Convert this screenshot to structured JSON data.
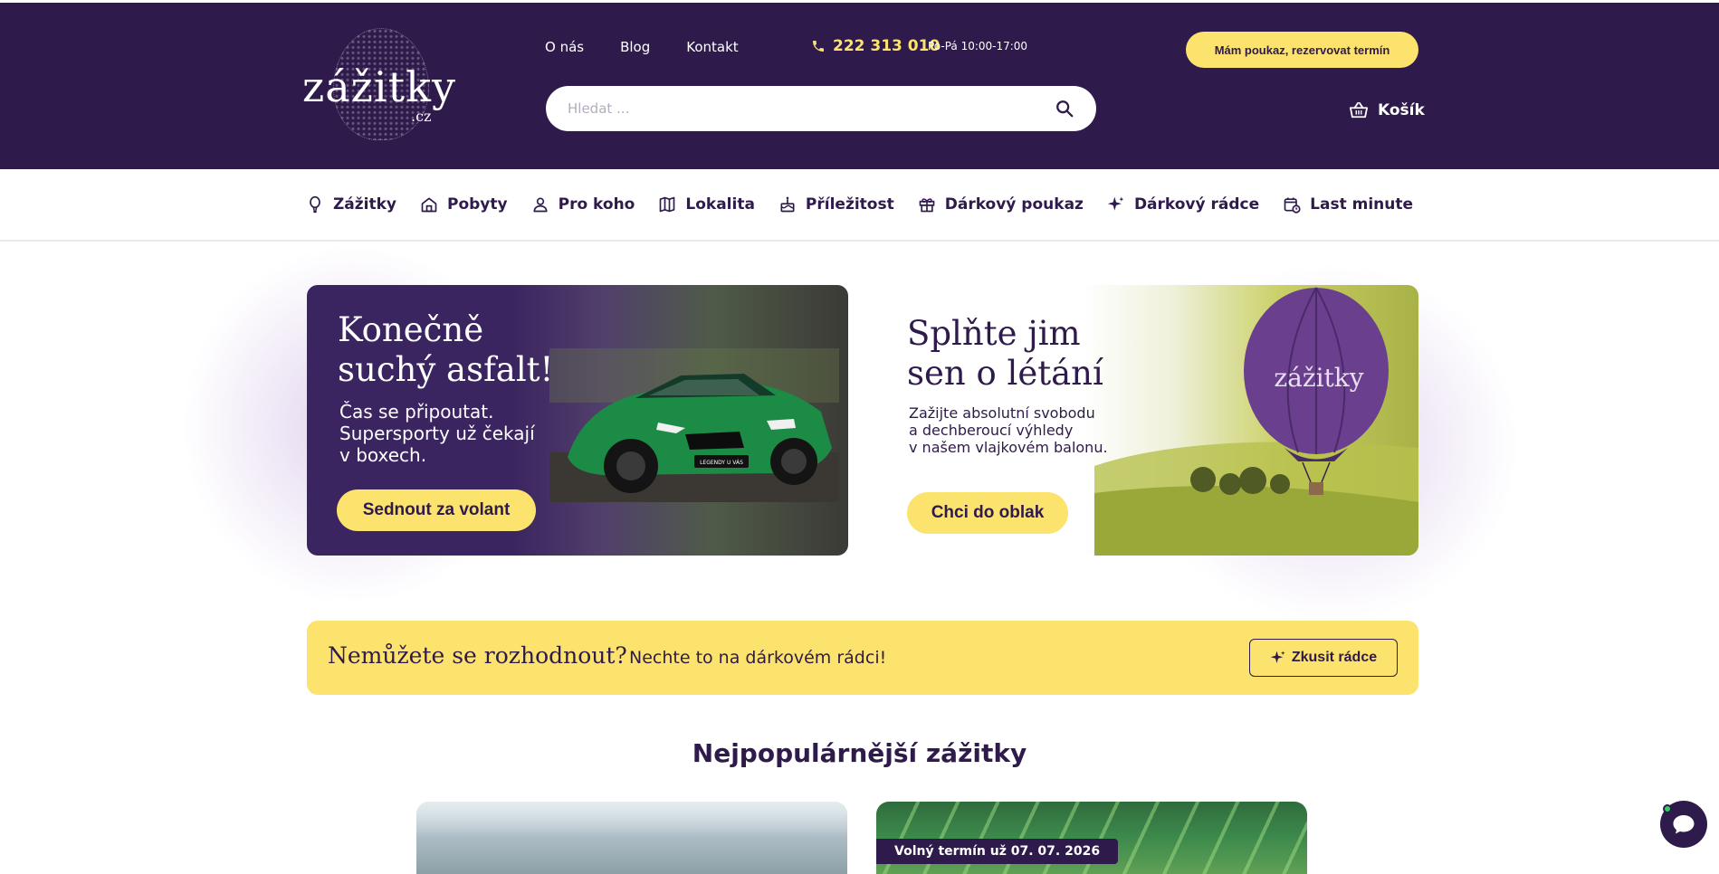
{
  "header": {
    "logo_text": "zážitky",
    "logo_suffix": ".cz",
    "nav": [
      "O nás",
      "Blog",
      "Kontakt"
    ],
    "phone": "222 313 010",
    "hours": "Po-Pá 10:00-17:00",
    "voucher_button": "Mám poukaz, rezervovat termín",
    "search_placeholder": "Hledat ...",
    "cart_label": "Košík"
  },
  "categories": [
    {
      "label": "Zážitky",
      "icon": "balloon-icon"
    },
    {
      "label": "Pobyty",
      "icon": "house-icon"
    },
    {
      "label": "Pro koho",
      "icon": "person-icon"
    },
    {
      "label": "Lokalita",
      "icon": "map-icon"
    },
    {
      "label": "Příležitost",
      "icon": "cake-icon"
    },
    {
      "label": "Dárkový poukaz",
      "icon": "gift-icon"
    },
    {
      "label": "Dárkový rádce",
      "icon": "sparkle-icon"
    },
    {
      "label": "Last minute",
      "icon": "calendar-clock-icon"
    }
  ],
  "banners": {
    "left": {
      "title_line1": "Konečně",
      "title_line2": "suchý asfalt!",
      "text_line1": "Čas se připoutat.",
      "text_line2": "Supersporty už čekají",
      "text_line3": "v boxech.",
      "button": "Sednout za volant",
      "plate_text": "LEGENDY U VÁS"
    },
    "right": {
      "title_line1": "Splňte jim",
      "title_line2": "sen o létání",
      "text_line1": "Zažijte absolutní svobodu",
      "text_line2": "a dechberoucí výhledy",
      "text_line3": "v našem vlajkovém balonu.",
      "button": "Chci do oblak",
      "balloon_text": "zážitky"
    }
  },
  "advisor": {
    "title": "Nemůžete se rozhodnout?",
    "subtitle": "Nechte to na dárkovém rádci!",
    "button": "Zkusit rádce"
  },
  "popular": {
    "title": "Nejpopulárnější zážitky",
    "card2_badge": "Volný termín už 07. 07. 2026"
  },
  "colors": {
    "primary": "#2e1a4b",
    "accent": "#fce36d",
    "online": "#35d05b"
  }
}
